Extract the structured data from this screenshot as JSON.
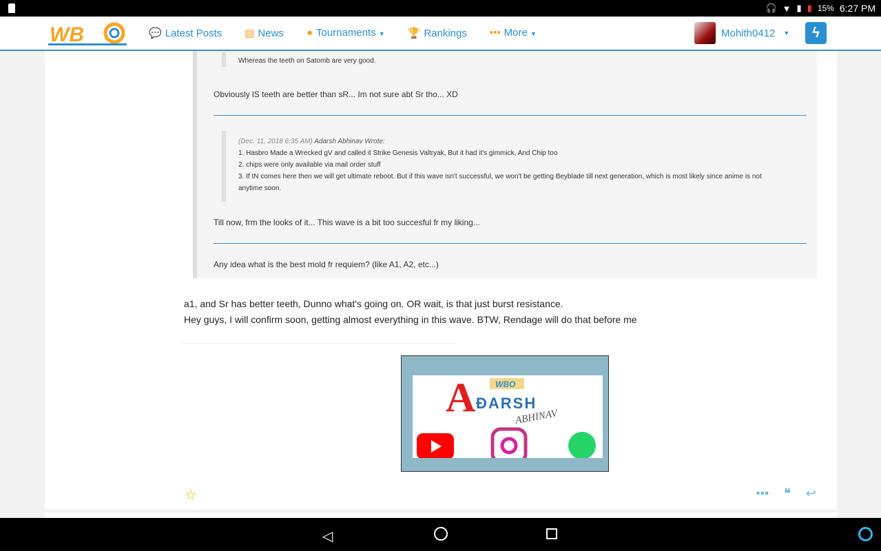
{
  "status_bar": {
    "battery": "15%",
    "time": "6:27 PM"
  },
  "header": {
    "logo": "WBO",
    "nav": [
      {
        "label": "Latest Posts",
        "icon": "comments-icon"
      },
      {
        "label": "News",
        "icon": "newspaper-icon"
      },
      {
        "label": "Tournaments",
        "icon": "globe-icon",
        "dropdown": true
      },
      {
        "label": "Rankings",
        "icon": "trophy-icon"
      },
      {
        "label": "More",
        "icon": "ellipsis-icon",
        "dropdown": true
      }
    ],
    "username": "Mohith0412"
  },
  "post": {
    "quote_top_line": "Whereas the teeth on Satomb are very good.",
    "reply1": "Obviously lS teeth are better than sR... Im not sure abt Sr tho... XD",
    "inner_quote": {
      "date": "(Dec. 11, 2018  6:35 AM)",
      "author": "Adarsh Abhinav Wrote:",
      "lines": [
        "1. Hasbro Made a Wrecked gV and called it Strike Genesis Valtryak, But it had it's gimmick, And Chip too",
        "2. chips were only available via mail order stuff",
        "3. If tN comes here then we will get ultimate reboot. But if this wave isn't successful, we won't be getting Beyblade till next generation, which is most likely since anime is not anytime soon."
      ]
    },
    "reply2": "Till now, frm the looks of it... This wave is a bit too succesful fr my liking...",
    "reply3": "Any idea what is the best mold fr requiem? (like A1, A2, etc...)",
    "body": [
      "a1, and Sr has better teeth, Dunno what's going on. OR wait, is that  just burst resistance.",
      "Hey guys, I will confirm soon, getting almost everything in this wave. BTW, Rendage will do that before me"
    ],
    "signature": {
      "text": "ADARSH ABHINAV",
      "logo": "WBO"
    }
  },
  "colors": {
    "accent": "#2a8fd0",
    "nav_icon": "#f0a020",
    "star": "#e8b800"
  }
}
